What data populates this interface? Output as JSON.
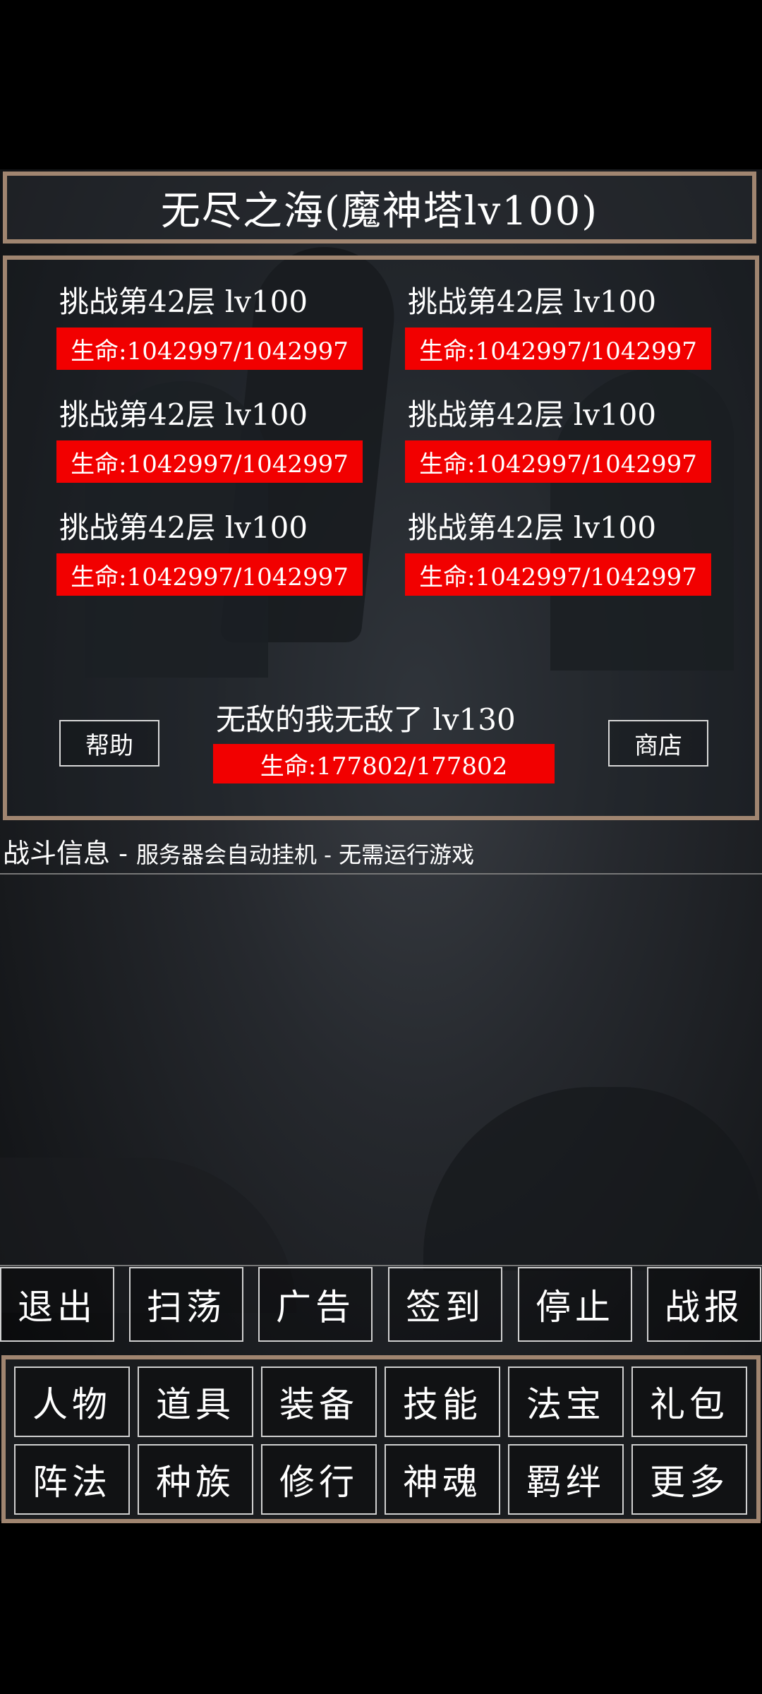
{
  "title": "无尽之海(魔神塔lv100)",
  "enemies": [
    {
      "name": "挑战第42层  lv100",
      "hp": "生命:1042997/1042997"
    },
    {
      "name": "挑战第42层  lv100",
      "hp": "生命:1042997/1042997"
    },
    {
      "name": "挑战第42层  lv100",
      "hp": "生命:1042997/1042997"
    },
    {
      "name": "挑战第42层  lv100",
      "hp": "生命:1042997/1042997"
    },
    {
      "name": "挑战第42层  lv100",
      "hp": "生命:1042997/1042997"
    },
    {
      "name": "挑战第42层  lv100",
      "hp": "生命:1042997/1042997"
    }
  ],
  "player": {
    "name": "无敌的我无敌了  lv130",
    "hp": "生命:177802/177802"
  },
  "help_label": "帮助",
  "shop_label": "商店",
  "battle_info": {
    "title": "战斗信息 - ",
    "subtitle": "服务器会自动挂机 - 无需运行游戏"
  },
  "actions": [
    "退出",
    "扫荡",
    "广告",
    "签到",
    "停止",
    "战报"
  ],
  "menu_row1": [
    "人物",
    "道具",
    "装备",
    "技能",
    "法宝",
    "礼包"
  ],
  "menu_row2": [
    "阵法",
    "种族",
    "修行",
    "神魂",
    "羁绊",
    "更多"
  ],
  "colors": {
    "hp_bar": "#f20000",
    "frame": "#a08570",
    "background": "#000000"
  }
}
